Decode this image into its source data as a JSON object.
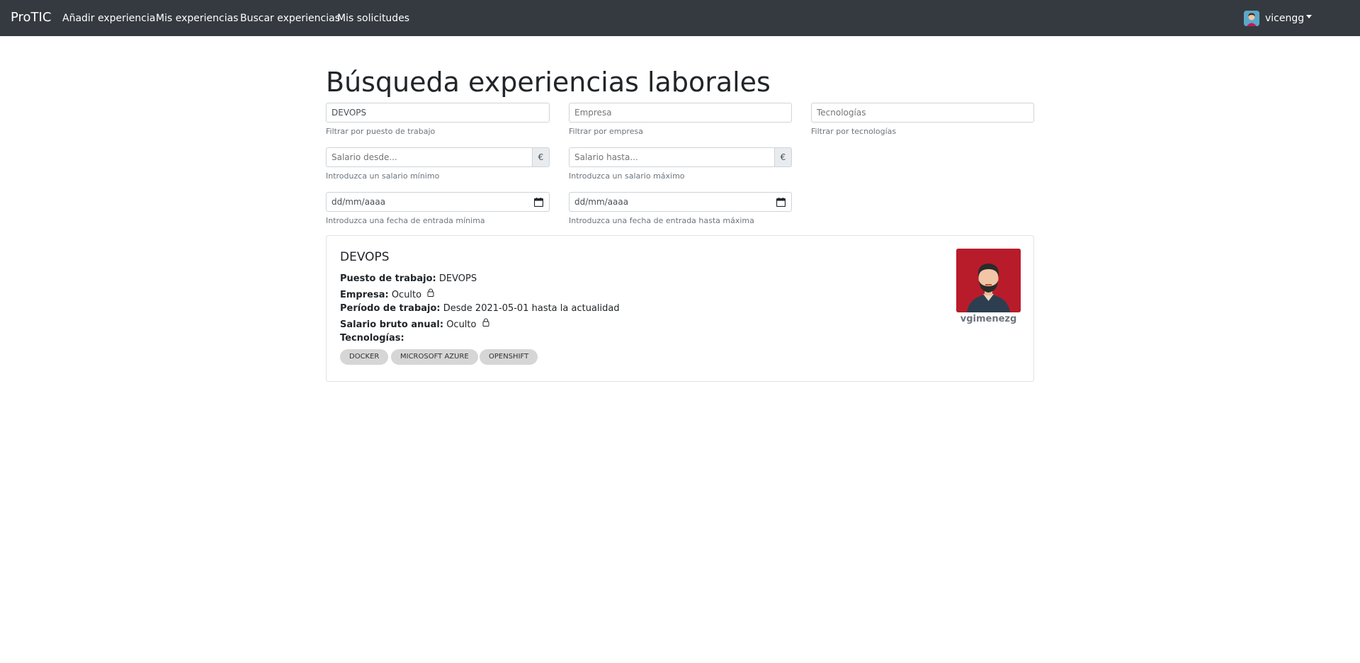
{
  "navbar": {
    "brand": "ProTIC",
    "links": [
      {
        "label": "Añadir experiencia"
      },
      {
        "label": "Mis experiencias"
      },
      {
        "label": "Buscar experiencias"
      },
      {
        "label": "Mis solicitudes"
      }
    ],
    "user": {
      "name": "vicengg",
      "icon": "user-avatar-icon"
    }
  },
  "page": {
    "title": "Búsqueda experiencias laborales"
  },
  "filters": {
    "position": {
      "value": "DEVOPS",
      "placeholder": "Puesto de trabajo",
      "help": "Filtrar por puesto de trabajo"
    },
    "company": {
      "value": "",
      "placeholder": "Empresa",
      "help": "Filtrar por empresa"
    },
    "technologies": {
      "value": "",
      "placeholder": "Tecnologías",
      "help": "Filtrar por tecnologías"
    },
    "salary_from": {
      "placeholder": "Salario desde...",
      "addon": "€",
      "help": "Introduzca un salario mínimo"
    },
    "salary_to": {
      "placeholder": "Salario hasta...",
      "addon": "€",
      "help": "Introduzca un salario máximo"
    },
    "date_from": {
      "value": "dd/mm/aaaa",
      "help": "Introduzca una fecha de entrada mínima"
    },
    "date_to": {
      "value": "dd/mm/aaaa",
      "help": "Introduzca una fecha de entrada hasta máxima"
    }
  },
  "results": [
    {
      "title": "DEVOPS",
      "position_label": "Puesto de trabajo:",
      "position_value": "DEVOPS",
      "company_label": "Empresa:",
      "company_value": "Oculto",
      "period_label": "Período de trabajo:",
      "period_value": "Desde 2021-05-01 hasta la actualidad",
      "salary_label": "Salario bruto anual:",
      "salary_value": "Oculto",
      "tech_label": "Tecnologías:",
      "technologies": [
        "DOCKER",
        "MICROSOFT AZURE",
        "OPENSHIFT"
      ],
      "username": "vgimenezg",
      "avatar_color": "#b81c2a"
    }
  ],
  "colors": {
    "navbar_bg": "#343a40",
    "badge_bg": "#d6d6d6"
  }
}
